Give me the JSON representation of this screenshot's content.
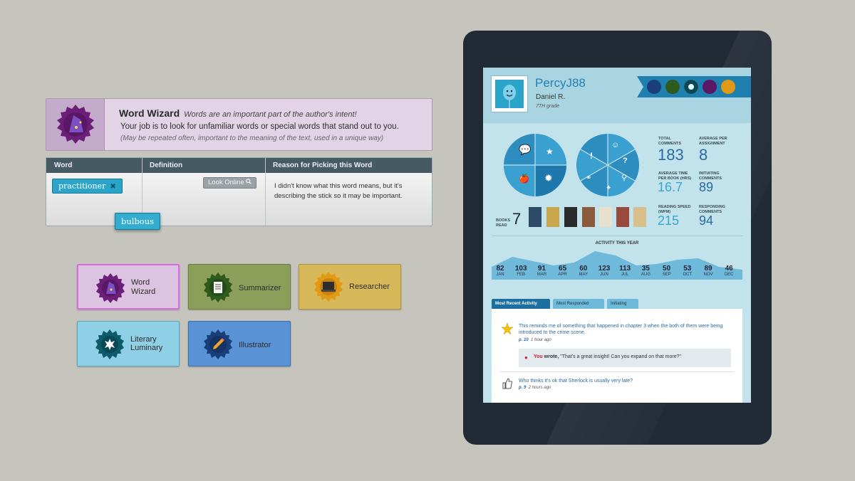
{
  "word_wizard": {
    "title": "Word Wizard",
    "subtitle": "Words are an important part of the author's intent!",
    "line1": "Your job is to look for unfamiliar words or special words that stand out to you.",
    "line2": "(May be repeated often, important to the meaning of the text, used in a unique way)"
  },
  "word_table": {
    "headers": [
      "Word",
      "Definition",
      "Reason for Picking this Word"
    ],
    "word_chip": "practitioner",
    "lookup_label": "Look Online",
    "reason": "I didn't know what this word means, but it's describing the stick so it may be important.",
    "dragged_chip": "bulbous"
  },
  "roles": [
    {
      "label": "Word Wizard",
      "line1": "Word",
      "line2": "Wizard"
    },
    {
      "label": "Summarizer"
    },
    {
      "label": "Researcher"
    },
    {
      "label": "Literary Luminary",
      "line1": "Literary",
      "line2": "Luminary"
    },
    {
      "label": "Illustrator"
    }
  ],
  "profile": {
    "username": "PercyJ88",
    "name": "Daniel R.",
    "grade": "7TH grade"
  },
  "stats": {
    "books_read_label": "BOOKS READ",
    "books_read": "7",
    "total_comments_label": "TOTAL COMMENTS",
    "total_comments": "183",
    "avg_per_assignment_label": "AVERAGE PER ASSIGNMENT",
    "avg_per_assignment": "8",
    "avg_time_label": "AVERAGE TIME PER BOOK (HRS)",
    "avg_time": "16.7",
    "initiating_label": "INITIATING COMMENTS",
    "initiating": "89",
    "reading_speed_label": "READING SPEED (WPM)",
    "reading_speed": "215",
    "responding_label": "RESPONDING COMMENTS",
    "responding": "94"
  },
  "activity": {
    "title": "ACTIVITY THIS YEAR",
    "months": [
      {
        "m": "JAN",
        "v": "82"
      },
      {
        "m": "FEB",
        "v": "103"
      },
      {
        "m": "MAR",
        "v": "91"
      },
      {
        "m": "APR",
        "v": "65"
      },
      {
        "m": "MAY",
        "v": "60"
      },
      {
        "m": "JUN",
        "v": "123"
      },
      {
        "m": "JUL",
        "v": "113"
      },
      {
        "m": "AUG",
        "v": "35"
      },
      {
        "m": "SEP",
        "v": "50"
      },
      {
        "m": "OCT",
        "v": "53"
      },
      {
        "m": "NOV",
        "v": "89"
      },
      {
        "m": "DEC",
        "v": "46"
      }
    ]
  },
  "tabs": [
    "Most Recent Activity",
    "Most Responded",
    "Initiating"
  ],
  "feed": [
    {
      "text": "This reminds me of something that happened in chapter 3 when the both of them were being introduced to the crime scene.",
      "page": "p. 10",
      "time": "1 hour ago",
      "reply_you": "You",
      "reply_wrote": "wrote,",
      "reply_text": "\"That's a great insight! Can you expand on that more?\""
    },
    {
      "text": "Who thinks it's ok that Sherlock is usually very late?",
      "page": "p. 9",
      "time": "2 hours ago"
    }
  ],
  "colors": {
    "accent": "#2aa4c8",
    "panel": "#455a63",
    "screen": "#c3e3ec"
  }
}
